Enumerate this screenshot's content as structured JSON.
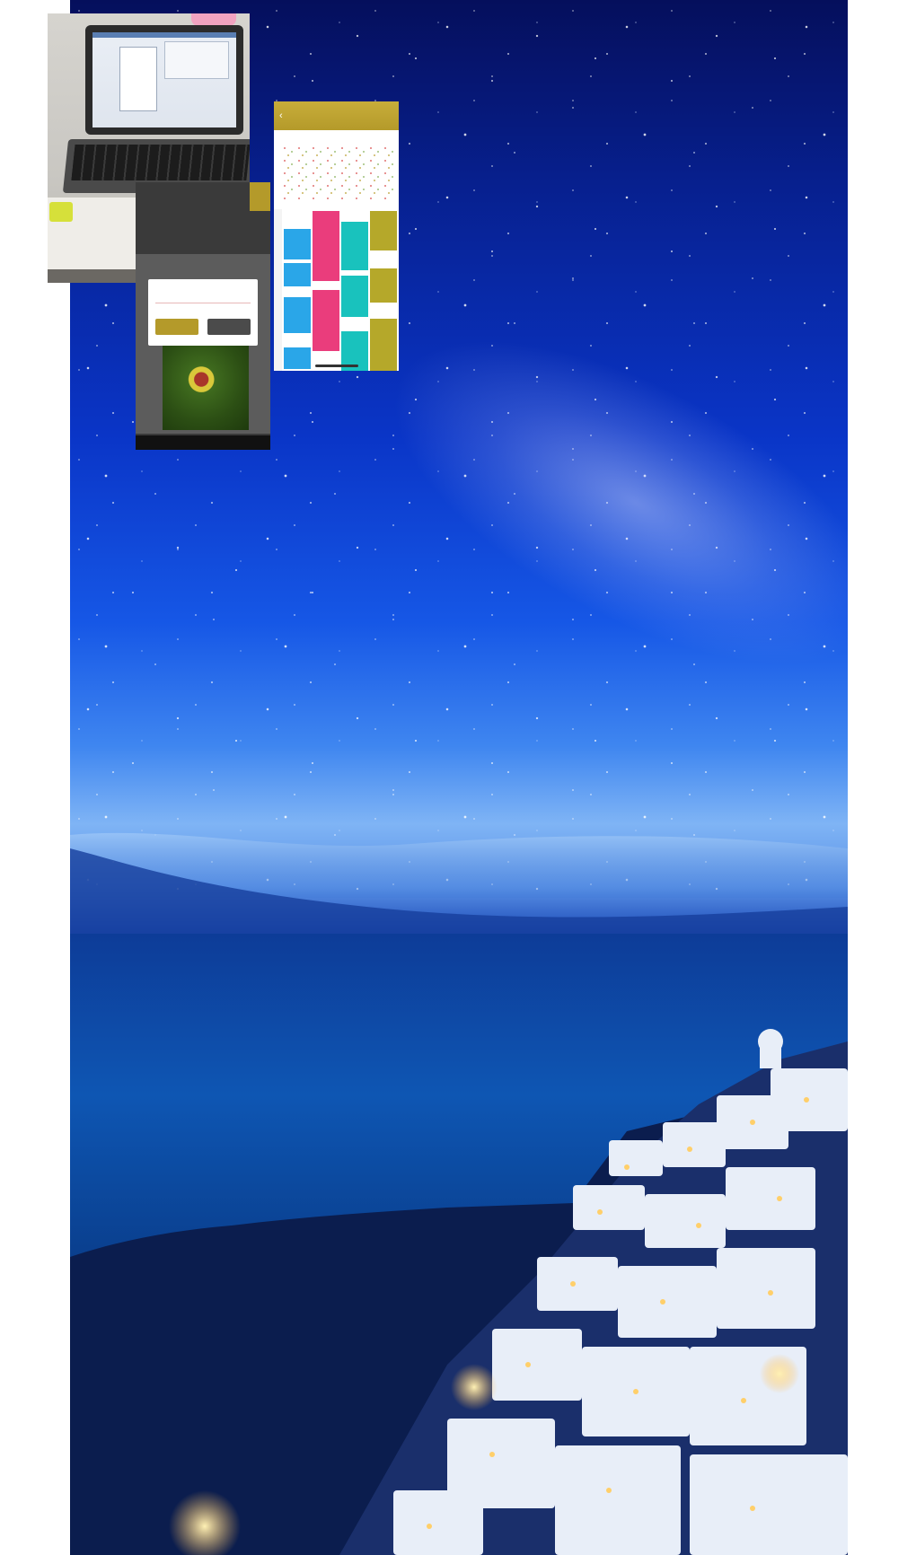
{
  "wallpaper": {
    "scene": "starry-night-sky-over-seaside-cliff-village",
    "colors": {
      "sky_top": "#050f5c",
      "sky_mid": "#1657e6",
      "horizon": "#7fb4f5",
      "sea": "#0c4aa6",
      "village_light": "#ffd27a"
    }
  },
  "thumbnails": {
    "laptop_photo": {
      "icon": "laptop-photo"
    },
    "phone_dialog": {
      "input_placeholder": "",
      "ok_label": "",
      "cancel_label": ""
    },
    "timetable": {
      "header_color": "#b49a2a",
      "block_colors": {
        "blue": "#2aa6e8",
        "pink": "#ea3d7c",
        "teal": "#19c2bd",
        "olive": "#b5a82a"
      }
    }
  }
}
